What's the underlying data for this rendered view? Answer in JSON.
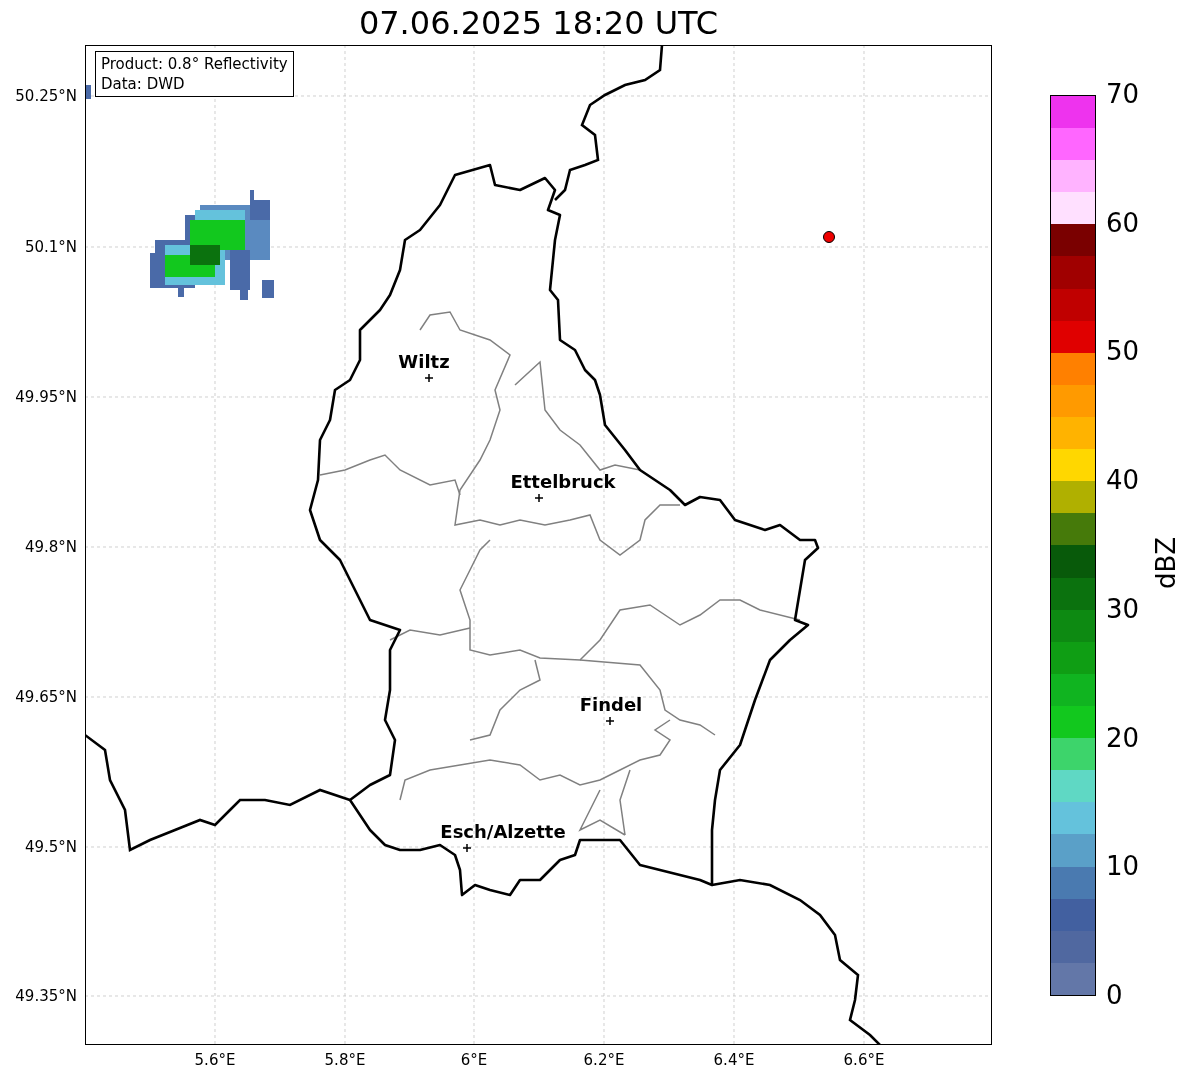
{
  "title": "07.06.2025 18:20 UTC",
  "info_box": [
    "Product: 0.8° Reflectivity",
    "Data: DWD"
  ],
  "y_ticks": [
    "50.25°N",
    "50.1°N",
    "49.95°N",
    "49.8°N",
    "49.65°N",
    "49.5°N",
    "49.35°N"
  ],
  "x_ticks": [
    "5.6°E",
    "5.8°E",
    "6°E",
    "6.2°E",
    "6.4°E",
    "6.6°E"
  ],
  "places": [
    {
      "name": "Wiltz"
    },
    {
      "name": "Ettelbruck"
    },
    {
      "name": "Findel"
    },
    {
      "name": "Esch/Alzette"
    }
  ],
  "colorbar": {
    "label": "dBZ",
    "ticks": [
      "70",
      "60",
      "50",
      "40",
      "30",
      "20",
      "10",
      "0"
    ],
    "bins": [
      {
        "color": "#6377a8"
      },
      {
        "color": "#5068a0"
      },
      {
        "color": "#4260a0"
      },
      {
        "color": "#4a7ab0"
      },
      {
        "color": "#5aa0c8"
      },
      {
        "color": "#64c2dc"
      },
      {
        "color": "#5fd8c4"
      },
      {
        "color": "#3dd46b"
      },
      {
        "color": "#12c81e"
      },
      {
        "color": "#10b420"
      },
      {
        "color": "#0f9e14"
      },
      {
        "color": "#0d8a12"
      },
      {
        "color": "#0b720e"
      },
      {
        "color": "#085a0a"
      },
      {
        "color": "#467a0a"
      },
      {
        "color": "#b0b000"
      },
      {
        "color": "#ffd700"
      },
      {
        "color": "#ffb300"
      },
      {
        "color": "#ff9a00"
      },
      {
        "color": "#ff8000"
      },
      {
        "color": "#e00000"
      },
      {
        "color": "#c00000"
      },
      {
        "color": "#a00000"
      },
      {
        "color": "#7a0000"
      },
      {
        "color": "#ffe0ff"
      },
      {
        "color": "#ffb3ff"
      },
      {
        "color": "#ff66ff"
      },
      {
        "color": "#ee33ee"
      }
    ]
  }
}
